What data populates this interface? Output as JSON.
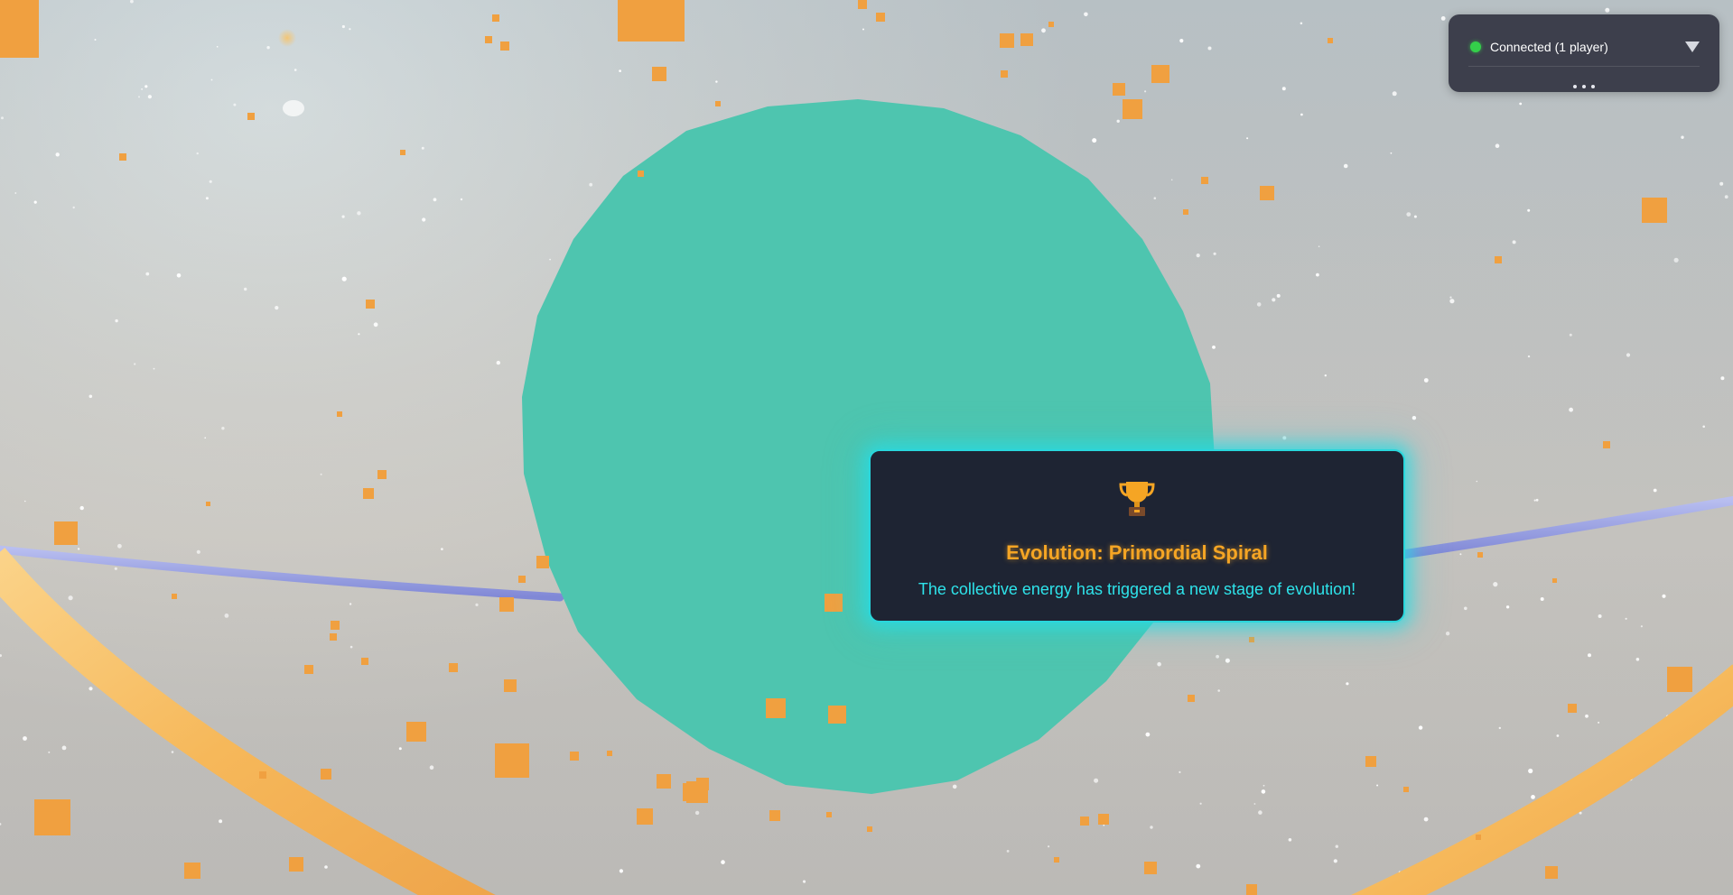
{
  "connection": {
    "status_text": "Connected (1 player)",
    "status_color": "#34d04a",
    "toggle_icon": "triangle-down-icon",
    "more_icon": "more-dots-icon"
  },
  "notification": {
    "icon": "trophy-icon",
    "title": "Evolution: Primordial Spiral",
    "message": "The collective energy has triggered a new stage of evolution!",
    "title_color": "#f5a524",
    "message_color": "#2ee3ea",
    "border_color": "#29d6dc"
  },
  "scene": {
    "core_orb_color": "#4ec5af",
    "ring_color": "#f7b95c",
    "orbit_line_color": "#8f98de",
    "particle_color": "#f0a040",
    "star_color": "#ffffff"
  }
}
